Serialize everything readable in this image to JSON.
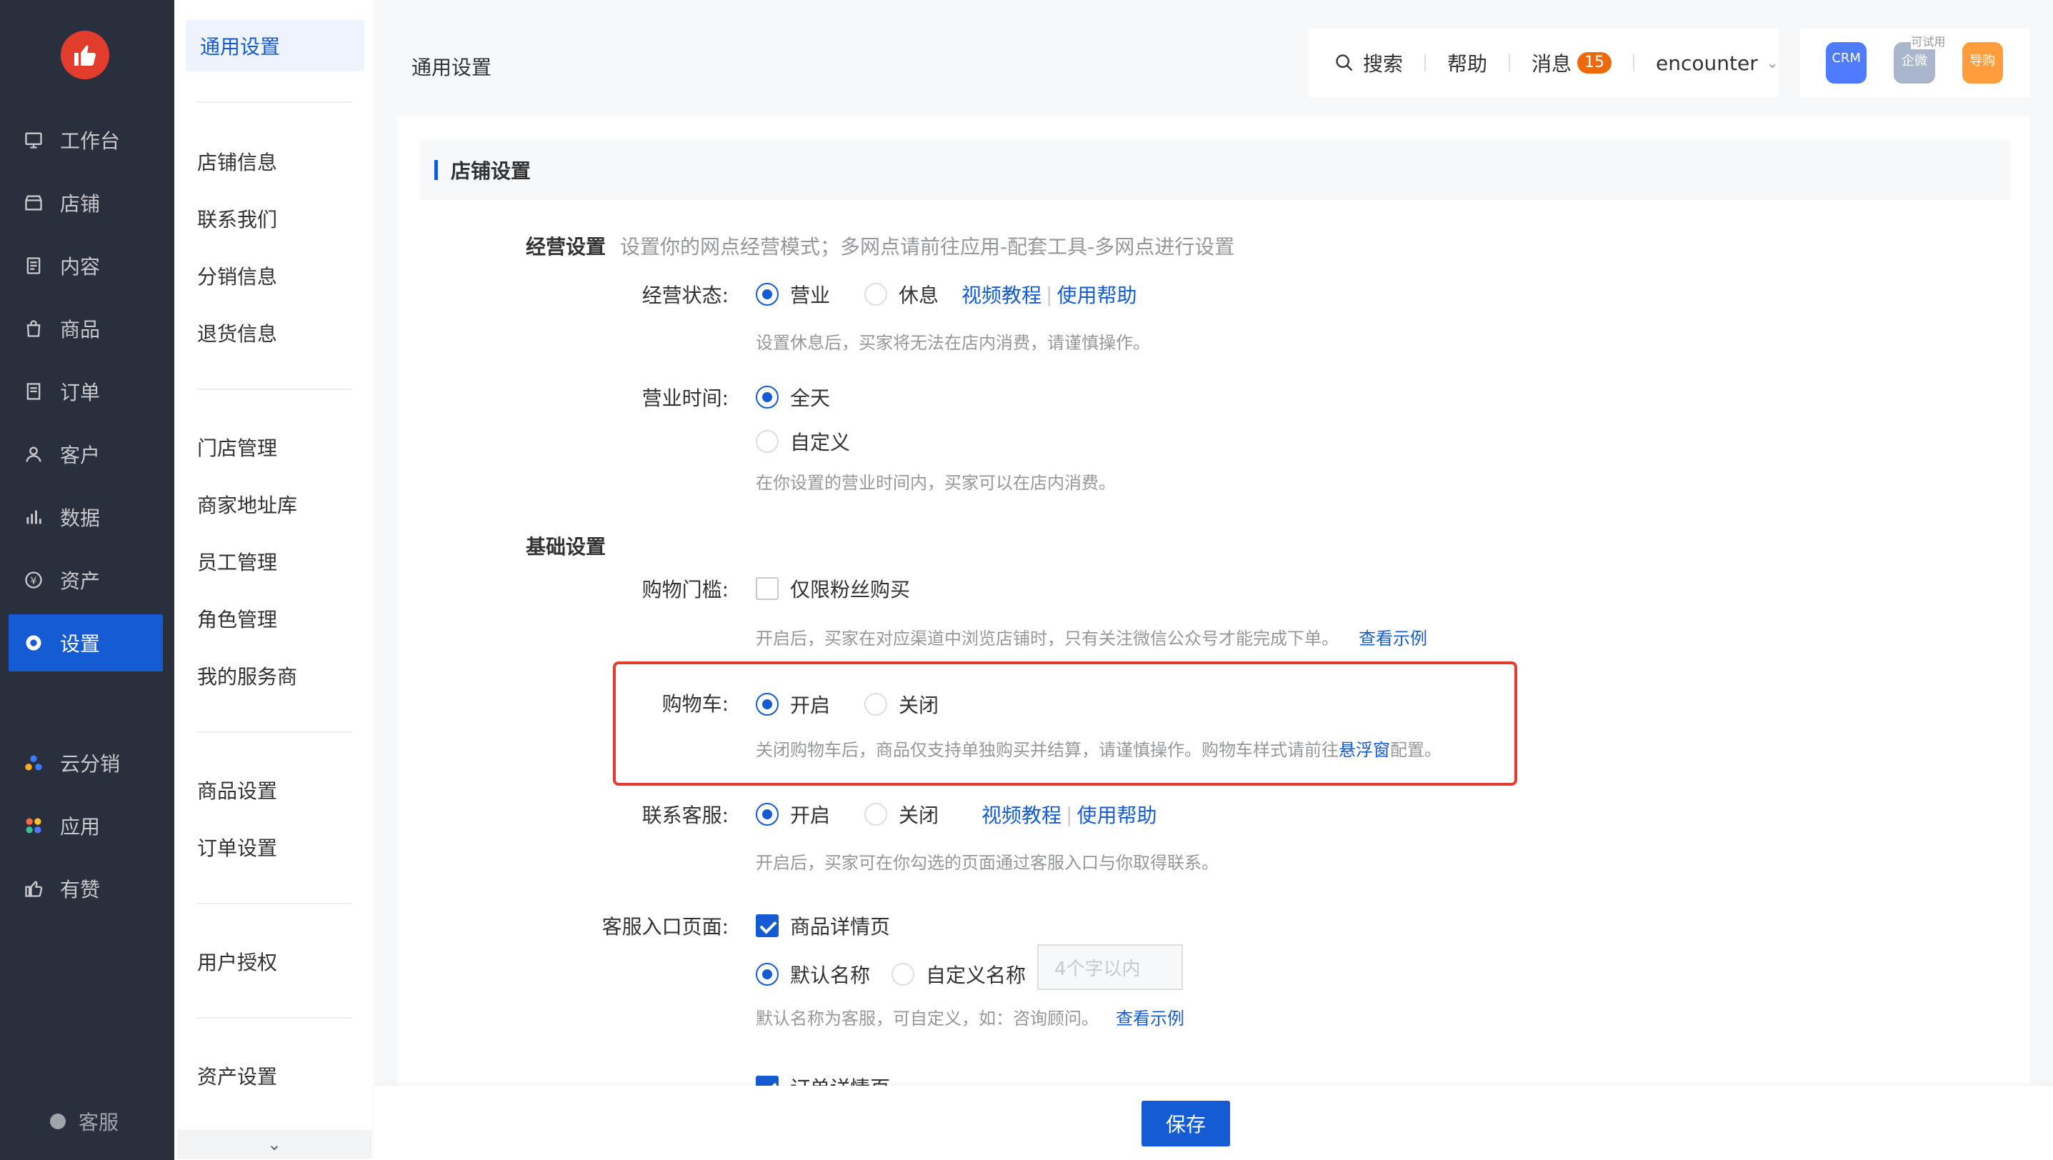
{
  "nav": {
    "items": [
      {
        "label": "工作台",
        "icon": "workbench-icon"
      },
      {
        "label": "店铺",
        "icon": "store-icon"
      },
      {
        "label": "内容",
        "icon": "content-icon"
      },
      {
        "label": "商品",
        "icon": "goods-icon"
      },
      {
        "label": "订单",
        "icon": "order-icon"
      },
      {
        "label": "客户",
        "icon": "customer-icon"
      },
      {
        "label": "数据",
        "icon": "data-icon"
      },
      {
        "label": "资产",
        "icon": "asset-icon"
      },
      {
        "label": "设置",
        "icon": "settings-icon",
        "active": true
      },
      {
        "label": "云分销",
        "icon": "cloud-distribution-icon"
      },
      {
        "label": "应用",
        "icon": "apps-icon"
      },
      {
        "label": "有赞",
        "icon": "youzan-thumb-icon"
      }
    ],
    "footer": "客服",
    "accent": "#155bd4",
    "background": "#2a2f3d"
  },
  "subnav": {
    "active": "通用设置",
    "items": [
      "店铺信息",
      "联系我们",
      "分销信息",
      "退货信息",
      "门店管理",
      "商家地址库",
      "员工管理",
      "角色管理",
      "我的服务商",
      "商品设置",
      "订单设置",
      "用户授权",
      "资产设置"
    ]
  },
  "header": {
    "title": "通用设置",
    "search": "搜索",
    "help": "帮助",
    "messages": "消息",
    "messages_count": "15",
    "user": "encounter",
    "apps": [
      {
        "label": "CRM",
        "color": "#4f7cff"
      },
      {
        "label": "企微",
        "trial": "可试用",
        "color": "#a9b6cc"
      },
      {
        "label": "导购",
        "color": "#ff9c3b"
      }
    ]
  },
  "section": {
    "title": "店铺设置"
  },
  "business": {
    "title": "经营设置",
    "desc": "设置你的网点经营模式；多网点请前往应用-配套工具-多网点进行设置",
    "status": {
      "label": "经营状态:",
      "options": [
        "营业",
        "休息"
      ],
      "selected": "营业",
      "link1": "视频教程",
      "link2": "使用帮助",
      "hint": "设置休息后，买家将无法在店内消费，请谨慎操作。"
    },
    "hours": {
      "label": "营业时间:",
      "options": [
        "全天",
        "自定义"
      ],
      "selected": "全天",
      "hint": "在你设置的营业时间内，买家可以在店内消费。"
    }
  },
  "basic": {
    "title": "基础设置",
    "threshold": {
      "label": "购物门槛:",
      "option": "仅限粉丝购买",
      "checked": false,
      "hint": "开启后，买家在对应渠道中浏览店铺时，只有关注微信公众号才能完成下单。",
      "link": "查看示例"
    },
    "cart": {
      "label": "购物车:",
      "options": [
        "开启",
        "关闭"
      ],
      "selected": "开启",
      "hint_prefix": "关闭购物车后，商品仅支持单独购买并结算，请谨慎操作。购物车样式请前往",
      "hint_link": "悬浮窗",
      "hint_suffix": "配置。"
    },
    "service": {
      "label": "联系客服:",
      "options": [
        "开启",
        "关闭"
      ],
      "selected": "开启",
      "link1": "视频教程",
      "link2": "使用帮助",
      "hint": "开启后，买家可在你勾选的页面通过客服入口与你取得联系。"
    },
    "entry": {
      "label": "客服入口页面:",
      "option1": "商品详情页",
      "option1_checked": true,
      "name_options": [
        "默认名称",
        "自定义名称"
      ],
      "name_selected": "默认名称",
      "placeholder": "4个字以内",
      "hint": "默认名称为客服，可自定义，如：咨询顾问。",
      "link": "查看示例",
      "option2": "订单详情页"
    }
  },
  "footer": {
    "save": "保存"
  }
}
